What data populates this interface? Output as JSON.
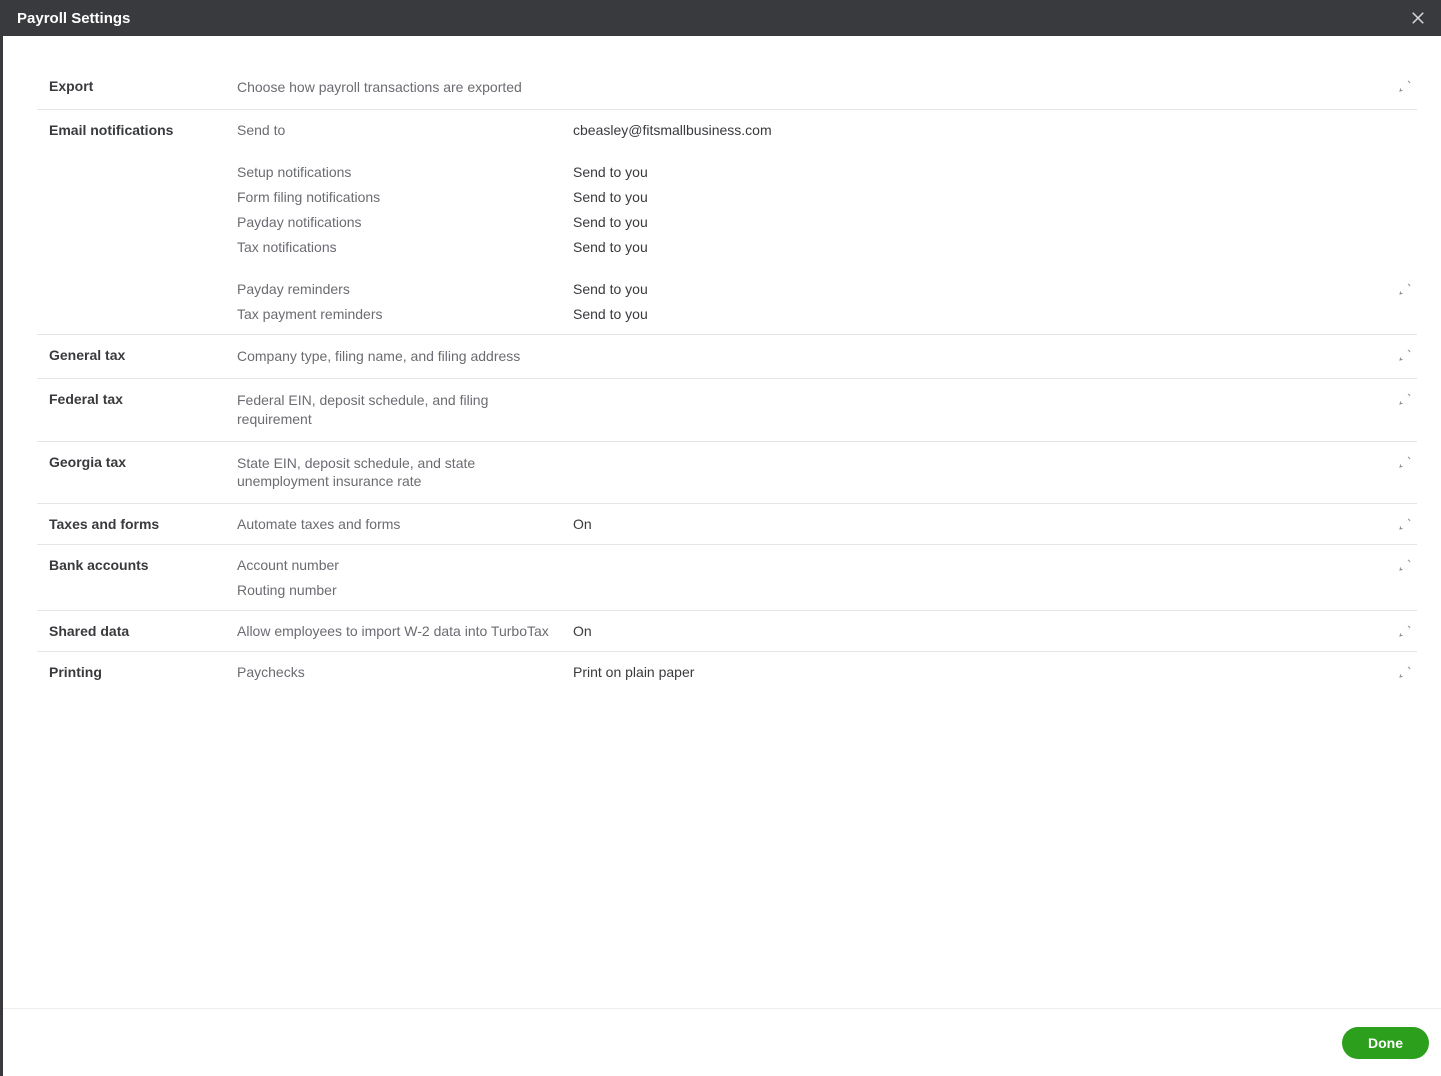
{
  "header": {
    "title": "Payroll Settings"
  },
  "sections": {
    "export": {
      "title": "Export",
      "desc": "Choose how payroll transactions are exported"
    },
    "email": {
      "title": "Email notifications",
      "send_to_label": "Send to",
      "send_to_value": "cbeasley@fitsmallbusiness.com",
      "rows": [
        {
          "label": "Setup notifications",
          "value": "Send to you"
        },
        {
          "label": "Form filing notifications",
          "value": "Send to you"
        },
        {
          "label": "Payday notifications",
          "value": "Send to you"
        },
        {
          "label": "Tax notifications",
          "value": "Send to you"
        }
      ],
      "rows2": [
        {
          "label": "Payday reminders",
          "value": "Send to you"
        },
        {
          "label": "Tax payment reminders",
          "value": "Send to you"
        }
      ]
    },
    "general_tax": {
      "title": "General tax",
      "desc": "Company type, filing name, and filing address"
    },
    "federal_tax": {
      "title": "Federal tax",
      "desc": "Federal EIN, deposit schedule, and filing requirement"
    },
    "georgia_tax": {
      "title": "Georgia tax",
      "desc": "State EIN, deposit schedule, and state unemployment insurance rate"
    },
    "taxes_forms": {
      "title": "Taxes and forms",
      "label": "Automate taxes and forms",
      "value": "On"
    },
    "bank": {
      "title": "Bank accounts",
      "rows": [
        {
          "label": "Account number"
        },
        {
          "label": "Routing number"
        }
      ]
    },
    "shared": {
      "title": "Shared data",
      "label": "Allow employees to import W-2 data into TurboTax",
      "value": "On"
    },
    "printing": {
      "title": "Printing",
      "label": "Paychecks",
      "value": "Print on plain paper"
    }
  },
  "footer": {
    "done": "Done"
  }
}
